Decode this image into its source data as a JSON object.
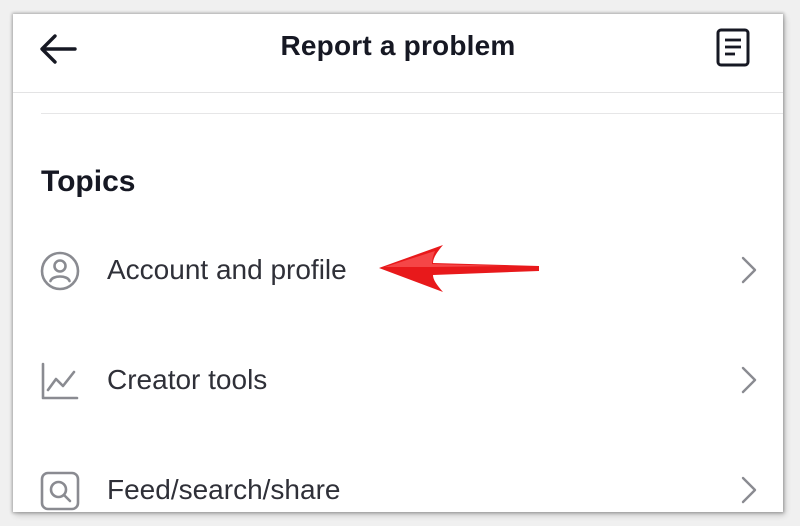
{
  "header": {
    "title": "Report a problem",
    "back_icon": "arrow-left-icon",
    "history_icon": "document-list-icon"
  },
  "topics": {
    "section_title": "Topics",
    "items": [
      {
        "label": "Account and profile",
        "icon": "person-circle-icon",
        "chevron": "chevron-right-icon"
      },
      {
        "label": "Creator tools",
        "icon": "line-chart-icon",
        "chevron": "chevron-right-icon"
      },
      {
        "label": "Feed/search/share",
        "icon": "search-square-icon",
        "chevron": "chevron-right-icon"
      }
    ]
  },
  "annotation": {
    "arrow_color": "#e8191b",
    "points_to": "Account and profile"
  },
  "colors": {
    "text_primary": "#161823",
    "text_row": "#2f3038",
    "icon_gray": "#8a8b91",
    "divider": "#e3e3e4"
  }
}
